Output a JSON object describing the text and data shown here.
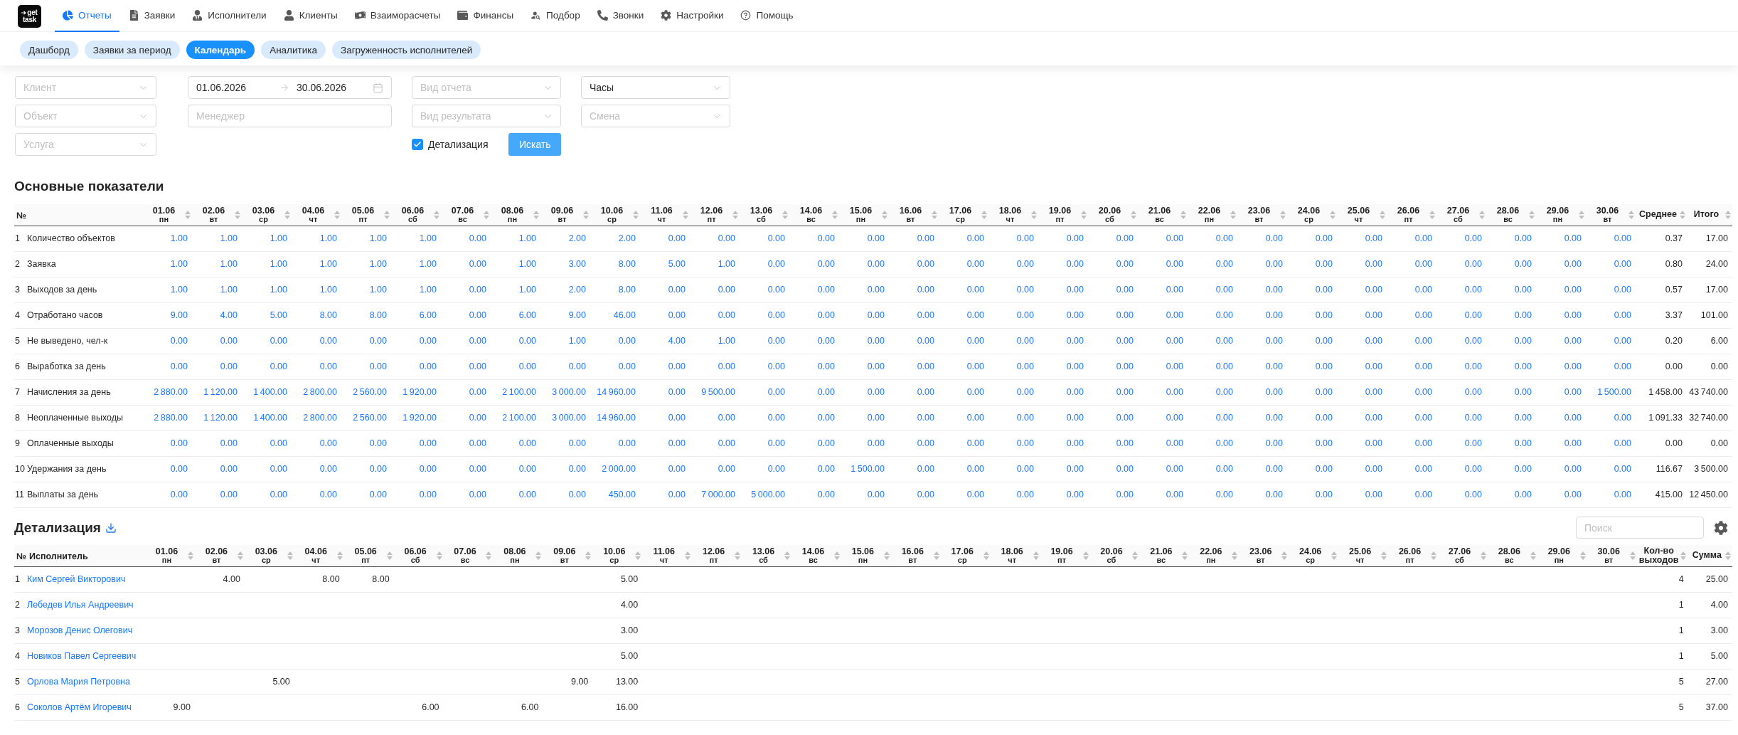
{
  "logo": {
    "lines": [
      "get",
      "task"
    ]
  },
  "nav": [
    {
      "label": "Отчеты",
      "selected": true
    },
    {
      "label": "Заявки",
      "selected": false
    },
    {
      "label": "Исполнители",
      "selected": false
    },
    {
      "label": "Клиенты",
      "selected": false
    },
    {
      "label": "Взаиморасчеты",
      "selected": false
    },
    {
      "label": "Финансы",
      "selected": false
    },
    {
      "label": "Подбор",
      "selected": false
    },
    {
      "label": "Звонки",
      "selected": false
    },
    {
      "label": "Настройки",
      "selected": false
    },
    {
      "label": "Помощь",
      "selected": false
    }
  ],
  "subtabs": [
    {
      "label": "Дашборд",
      "selected": false
    },
    {
      "label": "Заявки за период",
      "selected": false
    },
    {
      "label": "Календарь",
      "selected": true
    },
    {
      "label": "Аналитика",
      "selected": false
    },
    {
      "label": "Загруженность исполнителей",
      "selected": false
    }
  ],
  "filters": {
    "client": {
      "placeholder": "Клиент"
    },
    "object": {
      "placeholder": "Объект"
    },
    "service": {
      "placeholder": "Услуга"
    },
    "period": {
      "start": "01.06.2026",
      "end": "30.06.2026"
    },
    "manager": {
      "placeholder": "Менеджер"
    },
    "report_type": {
      "placeholder": "Вид отчета"
    },
    "result_type": {
      "placeholder": "Вид результата"
    },
    "detail_checkbox": {
      "label": "Детализация",
      "checked": true
    },
    "search_button": {
      "label": "Искать"
    },
    "units": {
      "value": "Часы"
    },
    "shift": {
      "placeholder": "Смена"
    }
  },
  "main": {
    "title": "Основные показатели",
    "columns": {
      "number": "№",
      "days": [
        {
          "date": "01.06",
          "weekday": "пн"
        },
        {
          "date": "02.06",
          "weekday": "вт"
        },
        {
          "date": "03.06",
          "weekday": "ср"
        },
        {
          "date": "04.06",
          "weekday": "чт"
        },
        {
          "date": "05.06",
          "weekday": "пт"
        },
        {
          "date": "06.06",
          "weekday": "сб"
        },
        {
          "date": "07.06",
          "weekday": "вс"
        },
        {
          "date": "08.06",
          "weekday": "пн"
        },
        {
          "date": "09.06",
          "weekday": "вт"
        },
        {
          "date": "10.06",
          "weekday": "ср"
        },
        {
          "date": "11.06",
          "weekday": "чт"
        },
        {
          "date": "12.06",
          "weekday": "пт"
        },
        {
          "date": "13.06",
          "weekday": "сб"
        },
        {
          "date": "14.06",
          "weekday": "вс"
        },
        {
          "date": "15.06",
          "weekday": "пн"
        },
        {
          "date": "16.06",
          "weekday": "вт"
        },
        {
          "date": "17.06",
          "weekday": "ср"
        },
        {
          "date": "18.06",
          "weekday": "чт"
        },
        {
          "date": "19.06",
          "weekday": "пт"
        },
        {
          "date": "20.06",
          "weekday": "сб"
        },
        {
          "date": "21.06",
          "weekday": "вс"
        },
        {
          "date": "22.06",
          "weekday": "пн"
        },
        {
          "date": "23.06",
          "weekday": "вт"
        },
        {
          "date": "24.06",
          "weekday": "ср"
        },
        {
          "date": "25.06",
          "weekday": "чт"
        },
        {
          "date": "26.06",
          "weekday": "пт"
        },
        {
          "date": "27.06",
          "weekday": "сб"
        },
        {
          "date": "28.06",
          "weekday": "вс"
        },
        {
          "date": "29.06",
          "weekday": "пн"
        },
        {
          "date": "30.06",
          "weekday": "вт"
        }
      ],
      "average": "Среднее",
      "total": "Итого"
    },
    "rows": [
      {
        "number": "1",
        "label": "Количество объектов",
        "values": [
          "1.00",
          "1.00",
          "1.00",
          "1.00",
          "1.00",
          "1.00",
          "0.00",
          "1.00",
          "2.00",
          "2.00",
          "0.00",
          "0.00",
          "0.00",
          "0.00",
          "0.00",
          "0.00",
          "0.00",
          "0.00",
          "0.00",
          "0.00",
          "0.00",
          "0.00",
          "0.00",
          "0.00",
          "0.00",
          "0.00",
          "0.00",
          "0.00",
          "0.00",
          "0.00"
        ],
        "average": "0.37",
        "total": "17.00"
      },
      {
        "number": "2",
        "label": "Заявка",
        "values": [
          "1.00",
          "1.00",
          "1.00",
          "1.00",
          "1.00",
          "1.00",
          "0.00",
          "1.00",
          "3.00",
          "8.00",
          "5.00",
          "1.00",
          "0.00",
          "0.00",
          "0.00",
          "0.00",
          "0.00",
          "0.00",
          "0.00",
          "0.00",
          "0.00",
          "0.00",
          "0.00",
          "0.00",
          "0.00",
          "0.00",
          "0.00",
          "0.00",
          "0.00",
          "0.00"
        ],
        "average": "0.80",
        "total": "24.00"
      },
      {
        "number": "3",
        "label": "Выходов за день",
        "values": [
          "1.00",
          "1.00",
          "1.00",
          "1.00",
          "1.00",
          "1.00",
          "0.00",
          "1.00",
          "2.00",
          "8.00",
          "0.00",
          "0.00",
          "0.00",
          "0.00",
          "0.00",
          "0.00",
          "0.00",
          "0.00",
          "0.00",
          "0.00",
          "0.00",
          "0.00",
          "0.00",
          "0.00",
          "0.00",
          "0.00",
          "0.00",
          "0.00",
          "0.00",
          "0.00"
        ],
        "average": "0.57",
        "total": "17.00"
      },
      {
        "number": "4",
        "label": "Отработано часов",
        "values": [
          "9.00",
          "4.00",
          "5.00",
          "8.00",
          "8.00",
          "6.00",
          "0.00",
          "6.00",
          "9.00",
          "46.00",
          "0.00",
          "0.00",
          "0.00",
          "0.00",
          "0.00",
          "0.00",
          "0.00",
          "0.00",
          "0.00",
          "0.00",
          "0.00",
          "0.00",
          "0.00",
          "0.00",
          "0.00",
          "0.00",
          "0.00",
          "0.00",
          "0.00",
          "0.00"
        ],
        "average": "3.37",
        "total": "101.00"
      },
      {
        "number": "5",
        "label": "Не выведено, чел-к",
        "values": [
          "0.00",
          "0.00",
          "0.00",
          "0.00",
          "0.00",
          "0.00",
          "0.00",
          "0.00",
          "1.00",
          "0.00",
          "4.00",
          "1.00",
          "0.00",
          "0.00",
          "0.00",
          "0.00",
          "0.00",
          "0.00",
          "0.00",
          "0.00",
          "0.00",
          "0.00",
          "0.00",
          "0.00",
          "0.00",
          "0.00",
          "0.00",
          "0.00",
          "0.00",
          "0.00"
        ],
        "average": "0.20",
        "total": "6.00"
      },
      {
        "number": "6",
        "label": "Выработка за день",
        "values": [
          "0.00",
          "0.00",
          "0.00",
          "0.00",
          "0.00",
          "0.00",
          "0.00",
          "0.00",
          "0.00",
          "0.00",
          "0.00",
          "0.00",
          "0.00",
          "0.00",
          "0.00",
          "0.00",
          "0.00",
          "0.00",
          "0.00",
          "0.00",
          "0.00",
          "0.00",
          "0.00",
          "0.00",
          "0.00",
          "0.00",
          "0.00",
          "0.00",
          "0.00",
          "0.00"
        ],
        "average": "0.00",
        "total": "0.00"
      },
      {
        "number": "7",
        "label": "Начисления за день",
        "values": [
          "2 880.00",
          "1 120.00",
          "1 400.00",
          "2 800.00",
          "2 560.00",
          "1 920.00",
          "0.00",
          "2 100.00",
          "3 000.00",
          "14 960.00",
          "0.00",
          "9 500.00",
          "0.00",
          "0.00",
          "0.00",
          "0.00",
          "0.00",
          "0.00",
          "0.00",
          "0.00",
          "0.00",
          "0.00",
          "0.00",
          "0.00",
          "0.00",
          "0.00",
          "0.00",
          "0.00",
          "0.00",
          "1 500.00"
        ],
        "average": "1 458.00",
        "total": "43 740.00"
      },
      {
        "number": "8",
        "label": "Неоплаченные выходы",
        "values": [
          "2 880.00",
          "1 120.00",
          "1 400.00",
          "2 800.00",
          "2 560.00",
          "1 920.00",
          "0.00",
          "2 100.00",
          "3 000.00",
          "14 960.00",
          "0.00",
          "0.00",
          "0.00",
          "0.00",
          "0.00",
          "0.00",
          "0.00",
          "0.00",
          "0.00",
          "0.00",
          "0.00",
          "0.00",
          "0.00",
          "0.00",
          "0.00",
          "0.00",
          "0.00",
          "0.00",
          "0.00",
          "0.00"
        ],
        "average": "1 091.33",
        "total": "32 740.00"
      },
      {
        "number": "9",
        "label": "Оплаченные выходы",
        "values": [
          "0.00",
          "0.00",
          "0.00",
          "0.00",
          "0.00",
          "0.00",
          "0.00",
          "0.00",
          "0.00",
          "0.00",
          "0.00",
          "0.00",
          "0.00",
          "0.00",
          "0.00",
          "0.00",
          "0.00",
          "0.00",
          "0.00",
          "0.00",
          "0.00",
          "0.00",
          "0.00",
          "0.00",
          "0.00",
          "0.00",
          "0.00",
          "0.00",
          "0.00",
          "0.00"
        ],
        "average": "0.00",
        "total": "0.00"
      },
      {
        "number": "10",
        "label": "Удержания за день",
        "values": [
          "0.00",
          "0.00",
          "0.00",
          "0.00",
          "0.00",
          "0.00",
          "0.00",
          "0.00",
          "0.00",
          "2 000.00",
          "0.00",
          "0.00",
          "0.00",
          "0.00",
          "1 500.00",
          "0.00",
          "0.00",
          "0.00",
          "0.00",
          "0.00",
          "0.00",
          "0.00",
          "0.00",
          "0.00",
          "0.00",
          "0.00",
          "0.00",
          "0.00",
          "0.00",
          "0.00"
        ],
        "average": "116.67",
        "total": "3 500.00"
      },
      {
        "number": "11",
        "label": "Выплаты за день",
        "values": [
          "0.00",
          "0.00",
          "0.00",
          "0.00",
          "0.00",
          "0.00",
          "0.00",
          "0.00",
          "0.00",
          "450.00",
          "0.00",
          "7 000.00",
          "5 000.00",
          "0.00",
          "0.00",
          "0.00",
          "0.00",
          "0.00",
          "0.00",
          "0.00",
          "0.00",
          "0.00",
          "0.00",
          "0.00",
          "0.00",
          "0.00",
          "0.00",
          "0.00",
          "0.00",
          "0.00"
        ],
        "average": "415.00",
        "total": "12 450.00"
      }
    ]
  },
  "detail": {
    "title": "Детализация",
    "search": {
      "placeholder": "Поиск"
    },
    "columns": {
      "number": "№",
      "name": "Исполнитель",
      "days": [
        {
          "date": "01.06",
          "weekday": "пн"
        },
        {
          "date": "02.06",
          "weekday": "вт"
        },
        {
          "date": "03.06",
          "weekday": "ср"
        },
        {
          "date": "04.06",
          "weekday": "чт"
        },
        {
          "date": "05.06",
          "weekday": "пт"
        },
        {
          "date": "06.06",
          "weekday": "сб"
        },
        {
          "date": "07.06",
          "weekday": "вс"
        },
        {
          "date": "08.06",
          "weekday": "пн"
        },
        {
          "date": "09.06",
          "weekday": "вт"
        },
        {
          "date": "10.06",
          "weekday": "ср"
        },
        {
          "date": "11.06",
          "weekday": "чт"
        },
        {
          "date": "12.06",
          "weekday": "пт"
        },
        {
          "date": "13.06",
          "weekday": "сб"
        },
        {
          "date": "14.06",
          "weekday": "вс"
        },
        {
          "date": "15.06",
          "weekday": "пн"
        },
        {
          "date": "16.06",
          "weekday": "вт"
        },
        {
          "date": "17.06",
          "weekday": "ср"
        },
        {
          "date": "18.06",
          "weekday": "чт"
        },
        {
          "date": "19.06",
          "weekday": "пт"
        },
        {
          "date": "20.06",
          "weekday": "сб"
        },
        {
          "date": "21.06",
          "weekday": "вс"
        },
        {
          "date": "22.06",
          "weekday": "пн"
        },
        {
          "date": "23.06",
          "weekday": "вт"
        },
        {
          "date": "24.06",
          "weekday": "ср"
        },
        {
          "date": "25.06",
          "weekday": "чт"
        },
        {
          "date": "26.06",
          "weekday": "пт"
        },
        {
          "date": "27.06",
          "weekday": "сб"
        },
        {
          "date": "28.06",
          "weekday": "вс"
        },
        {
          "date": "29.06",
          "weekday": "пн"
        },
        {
          "date": "30.06",
          "weekday": "вт"
        }
      ],
      "count": "Кол-во выходов",
      "sum": "Сумма"
    },
    "rows": [
      {
        "number": "1",
        "name": "Ким Сергей Викторович",
        "cells": [
          {
            "kind": "blank"
          },
          {
            "kind": "value",
            "value": "4.00"
          },
          {
            "kind": "blank"
          },
          {
            "kind": "value",
            "value": "8.00"
          },
          {
            "kind": "value",
            "value": "8.00"
          },
          {
            "kind": "blank"
          },
          {
            "kind": "blank"
          },
          {
            "kind": "blank"
          },
          {
            "kind": "blank"
          },
          {
            "kind": "value",
            "value": "5.00"
          },
          {
            "kind": "blank"
          },
          {
            "kind": "blank"
          },
          {
            "kind": "blank"
          },
          {
            "kind": "blank"
          },
          {
            "kind": "blank"
          },
          {
            "kind": "blank"
          },
          {
            "kind": "blank"
          },
          {
            "kind": "blank"
          },
          {
            "kind": "blank"
          },
          {
            "kind": "blank"
          },
          {
            "kind": "blank"
          },
          {
            "kind": "blank"
          },
          {
            "kind": "blank"
          },
          {
            "kind": "blank"
          },
          {
            "kind": "blank"
          },
          {
            "kind": "blank"
          },
          {
            "kind": "blank"
          },
          {
            "kind": "blank"
          },
          {
            "kind": "blank"
          },
          {
            "kind": "blank"
          }
        ],
        "count": "4",
        "sum": "25.00"
      },
      {
        "number": "2",
        "name": "Лебедев Илья Андреевич",
        "cells": [
          {
            "kind": "blank"
          },
          {
            "kind": "blank"
          },
          {
            "kind": "blank"
          },
          {
            "kind": "blank"
          },
          {
            "kind": "blank"
          },
          {
            "kind": "blank"
          },
          {
            "kind": "blank"
          },
          {
            "kind": "blank"
          },
          {
            "kind": "blank"
          },
          {
            "kind": "value",
            "value": "4.00"
          },
          {
            "kind": "blank"
          },
          {
            "kind": "blank"
          },
          {
            "kind": "blank"
          },
          {
            "kind": "blank"
          },
          {
            "kind": "blank"
          },
          {
            "kind": "blank"
          },
          {
            "kind": "blank"
          },
          {
            "kind": "blank"
          },
          {
            "kind": "blank"
          },
          {
            "kind": "blank"
          },
          {
            "kind": "blank"
          },
          {
            "kind": "blank"
          },
          {
            "kind": "blank"
          },
          {
            "kind": "blank"
          },
          {
            "kind": "blank"
          },
          {
            "kind": "blank"
          },
          {
            "kind": "blank"
          },
          {
            "kind": "blank"
          },
          {
            "kind": "blank"
          },
          {
            "kind": "blank"
          }
        ],
        "count": "1",
        "sum": "4.00"
      },
      {
        "number": "3",
        "name": "Морозов Денис Олегович",
        "cells": [
          {
            "kind": "blank"
          },
          {
            "kind": "blank"
          },
          {
            "kind": "blank"
          },
          {
            "kind": "blank"
          },
          {
            "kind": "blank"
          },
          {
            "kind": "blank"
          },
          {
            "kind": "blank"
          },
          {
            "kind": "blank"
          },
          {
            "kind": "blank"
          },
          {
            "kind": "value",
            "value": "3.00"
          },
          {
            "kind": "blank"
          },
          {
            "kind": "blank"
          },
          {
            "kind": "blank"
          },
          {
            "kind": "blank"
          },
          {
            "kind": "blank"
          },
          {
            "kind": "blank"
          },
          {
            "kind": "blank"
          },
          {
            "kind": "blank"
          },
          {
            "kind": "blank"
          },
          {
            "kind": "blank"
          },
          {
            "kind": "blank"
          },
          {
            "kind": "blank"
          },
          {
            "kind": "blank"
          },
          {
            "kind": "blank"
          },
          {
            "kind": "blank"
          },
          {
            "kind": "blank"
          },
          {
            "kind": "blank"
          },
          {
            "kind": "blank"
          },
          {
            "kind": "blank"
          },
          {
            "kind": "blank"
          }
        ],
        "count": "1",
        "sum": "3.00"
      },
      {
        "number": "4",
        "name": "Новиков Павел Сергеевич",
        "cells": [
          {
            "kind": "blank"
          },
          {
            "kind": "blank"
          },
          {
            "kind": "blank"
          },
          {
            "kind": "blank"
          },
          {
            "kind": "blank"
          },
          {
            "kind": "blank"
          },
          {
            "kind": "blank"
          },
          {
            "kind": "blank"
          },
          {
            "kind": "blank"
          },
          {
            "kind": "value",
            "value": "5.00"
          },
          {
            "kind": "blank"
          },
          {
            "kind": "blank"
          },
          {
            "kind": "blank"
          },
          {
            "kind": "blank"
          },
          {
            "kind": "blank"
          },
          {
            "kind": "blank"
          },
          {
            "kind": "blank"
          },
          {
            "kind": "blank"
          },
          {
            "kind": "blank"
          },
          {
            "kind": "blank"
          },
          {
            "kind": "blank"
          },
          {
            "kind": "blank"
          },
          {
            "kind": "blank"
          },
          {
            "kind": "blank"
          },
          {
            "kind": "blank"
          },
          {
            "kind": "blank"
          },
          {
            "kind": "blank"
          },
          {
            "kind": "blank"
          },
          {
            "kind": "blank"
          },
          {
            "kind": "blank"
          }
        ],
        "count": "1",
        "sum": "5.00"
      },
      {
        "number": "5",
        "name": "Орлова Мария Петровна",
        "cells": [
          {
            "kind": "blank"
          },
          {
            "kind": "blank"
          },
          {
            "kind": "value",
            "value": "5.00"
          },
          {
            "kind": "blank"
          },
          {
            "kind": "blank"
          },
          {
            "kind": "blank"
          },
          {
            "kind": "blank"
          },
          {
            "kind": "blank"
          },
          {
            "kind": "value",
            "value": "9.00"
          },
          {
            "kind": "value",
            "value": "13.00"
          },
          {
            "kind": "blank"
          },
          {
            "kind": "blank"
          },
          {
            "kind": "blank"
          },
          {
            "kind": "blank"
          },
          {
            "kind": "blank"
          },
          {
            "kind": "blank"
          },
          {
            "kind": "blank"
          },
          {
            "kind": "blank"
          },
          {
            "kind": "blank"
          },
          {
            "kind": "blank"
          },
          {
            "kind": "blank"
          },
          {
            "kind": "blank"
          },
          {
            "kind": "blank"
          },
          {
            "kind": "blank"
          },
          {
            "kind": "blank"
          },
          {
            "kind": "blank"
          },
          {
            "kind": "blank"
          },
          {
            "kind": "blank"
          },
          {
            "kind": "blank"
          },
          {
            "kind": "blank"
          }
        ],
        "count": "5",
        "sum": "27.00"
      },
      {
        "number": "6",
        "name": "Соколов Артём Игоревич",
        "cells": [
          {
            "kind": "value",
            "value": "9.00"
          },
          {
            "kind": "blank"
          },
          {
            "kind": "blank"
          },
          {
            "kind": "blank"
          },
          {
            "kind": "blank"
          },
          {
            "kind": "value",
            "value": "6.00"
          },
          {
            "kind": "blank"
          },
          {
            "kind": "value",
            "value": "6.00"
          },
          {
            "kind": "blank"
          },
          {
            "kind": "value",
            "value": "16.00"
          },
          {
            "kind": "blank"
          },
          {
            "kind": "blank"
          },
          {
            "kind": "blank"
          },
          {
            "kind": "blank"
          },
          {
            "kind": "blank"
          },
          {
            "kind": "blank"
          },
          {
            "kind": "blank"
          },
          {
            "kind": "blank"
          },
          {
            "kind": "blank"
          },
          {
            "kind": "blank"
          },
          {
            "kind": "blank"
          },
          {
            "kind": "blank"
          },
          {
            "kind": "blank"
          },
          {
            "kind": "blank"
          },
          {
            "kind": "blank"
          },
          {
            "kind": "blank"
          },
          {
            "kind": "blank"
          },
          {
            "kind": "blank"
          },
          {
            "kind": "blank"
          },
          {
            "kind": "blank"
          }
        ],
        "count": "5",
        "sum": "37.00"
      }
    ]
  }
}
